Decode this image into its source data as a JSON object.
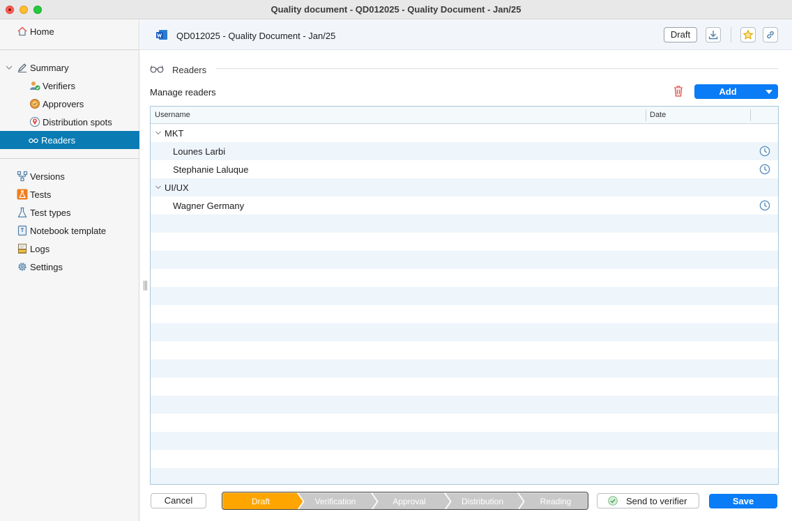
{
  "window": {
    "title": "Quality document - QD012025 - Quality Document - Jan/25"
  },
  "sidebar": {
    "home": "Home",
    "summary": "Summary",
    "sub_items": [
      "Verifiers",
      "Approvers",
      "Distribution spots",
      "Readers"
    ],
    "active": "Readers",
    "tools": [
      "Versions",
      "Tests",
      "Test types",
      "Notebook template",
      "Logs",
      "Settings"
    ]
  },
  "header": {
    "doc_title": "QD012025 - Quality Document - Jan/25",
    "status": "Draft"
  },
  "main": {
    "section_title": "Readers",
    "manage_label": "Manage readers",
    "add_label": "Add"
  },
  "table": {
    "columns": [
      "Username",
      "Date"
    ],
    "groups": [
      {
        "name": "MKT",
        "members": [
          "Lounes Larbi",
          "Stephanie Laluque"
        ]
      },
      {
        "name": "UI/UX",
        "members": [
          "Wagner Germany"
        ]
      }
    ]
  },
  "footer": {
    "cancel": "Cancel",
    "workflow_steps": [
      "Draft",
      "Verification",
      "Approval",
      "Distribution",
      "Reading"
    ],
    "current_step": "Draft",
    "send_label": "Send to verifier",
    "save": "Save"
  },
  "colors": {
    "accent": "#0a7cf5",
    "active_nav": "#0a7bb3",
    "current_step": "#ffa500",
    "inactive_step": "#c9c9c9",
    "row_stripe": "#eef5fb"
  }
}
